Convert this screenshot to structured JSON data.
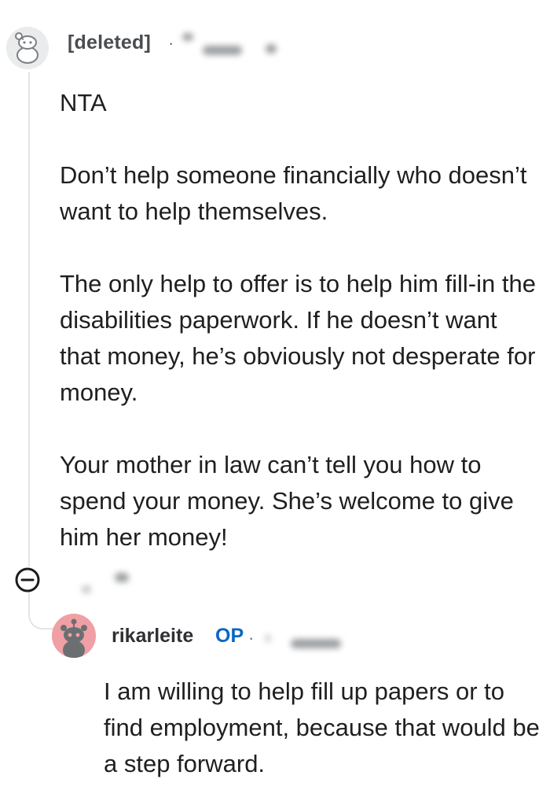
{
  "comment": {
    "author": "[deleted]",
    "avatar_icon": "snoo-deleted-icon",
    "meta_separator": "·",
    "paragraphs": [
      "NTA",
      "Don’t help someone financially who doesn’t want to help themselves.",
      "The only help to offer is to help him fill-in the disabilities paperwork. If he doesn’t want that money, he’s obviously not desperate for money.",
      "Your mother in law can’t tell you how to spend your money. She’s welcome to give him her money!"
    ]
  },
  "collapse": {
    "icon": "collapse-minus-icon"
  },
  "reply": {
    "author": "rikarleite",
    "badge": "OP",
    "meta_separator": "·",
    "avatar_icon": "snoo-avatar-icon",
    "avatar_color": "#f0a0a4",
    "text": "I am willing to help fill up papers or to find employment, because that would be a step forward."
  },
  "colors": {
    "op_badge": "#0a66c2",
    "thread_line": "#e2e4e6"
  }
}
